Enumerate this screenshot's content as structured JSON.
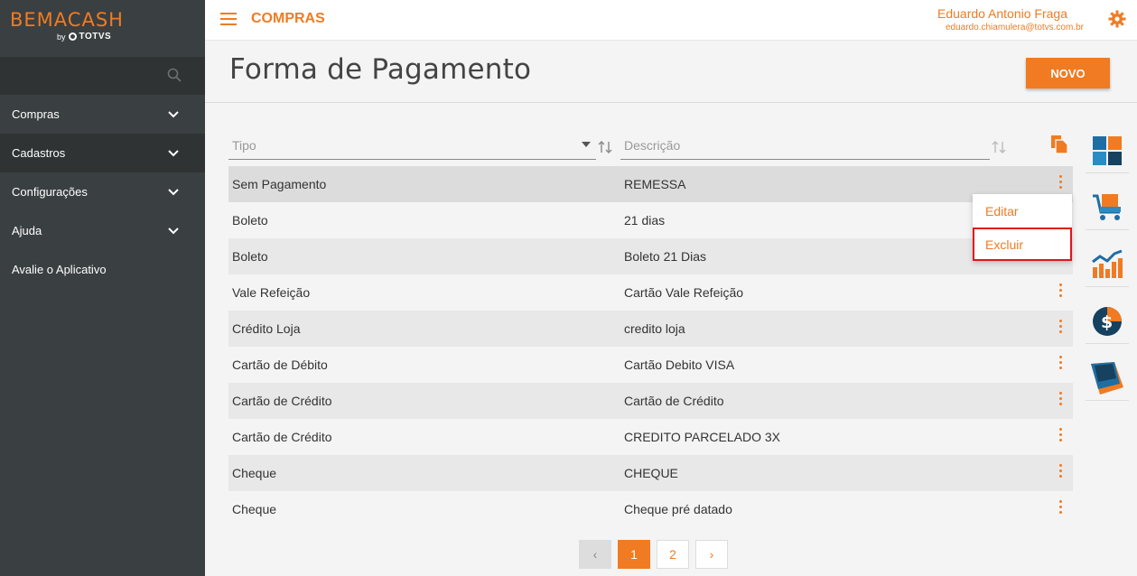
{
  "brand": {
    "name": "BEMACASH",
    "by": "by",
    "partner": "TOTVS"
  },
  "sidebar": {
    "items": [
      {
        "label": "Compras",
        "has_chevron": true
      },
      {
        "label": "Cadastros",
        "has_chevron": true
      },
      {
        "label": "Configurações",
        "has_chevron": true
      },
      {
        "label": "Ajuda",
        "has_chevron": true
      },
      {
        "label": "Avalie o Aplicativo",
        "has_chevron": false
      }
    ]
  },
  "header": {
    "section": "COMPRAS",
    "user_name": "Eduardo Antonio Fraga",
    "user_email": "eduardo.chiamulera@totvs.com.br"
  },
  "page": {
    "title": "Forma de Pagamento",
    "new_button": "NOVO"
  },
  "filters": {
    "tipo_placeholder": "Tipo",
    "descricao_placeholder": "Descrição"
  },
  "rows": [
    {
      "tipo": "Sem Pagamento",
      "descricao": "REMESSA"
    },
    {
      "tipo": "Boleto",
      "descricao": "21 dias"
    },
    {
      "tipo": "Boleto",
      "descricao": "Boleto 21 Dias"
    },
    {
      "tipo": "Vale Refeição",
      "descricao": "Cartão Vale Refeição"
    },
    {
      "tipo": "Crédito Loja",
      "descricao": "credito loja"
    },
    {
      "tipo": "Cartão de Débito",
      "descricao": "Cartão Debito VISA"
    },
    {
      "tipo": "Cartão de Crédito",
      "descricao": "Cartão de Crédito"
    },
    {
      "tipo": "Cartão de Crédito",
      "descricao": "CREDITO PARCELADO 3X"
    },
    {
      "tipo": "Cheque",
      "descricao": "CHEQUE"
    },
    {
      "tipo": "Cheque",
      "descricao": "Cheque pré datado"
    }
  ],
  "context_menu": {
    "edit": "Editar",
    "delete": "Excluir"
  },
  "pagination": {
    "prev": "‹",
    "pages": [
      "1",
      "2"
    ],
    "current": "1",
    "next": "›"
  },
  "colors": {
    "accent": "#f07b22",
    "sidebar": "#3a3f41",
    "highlight_border": "#e0141e"
  },
  "dock_icons": [
    "dashboard-app-icon",
    "cart-app-icon",
    "chart-app-icon",
    "finance-app-icon",
    "box-app-icon"
  ]
}
